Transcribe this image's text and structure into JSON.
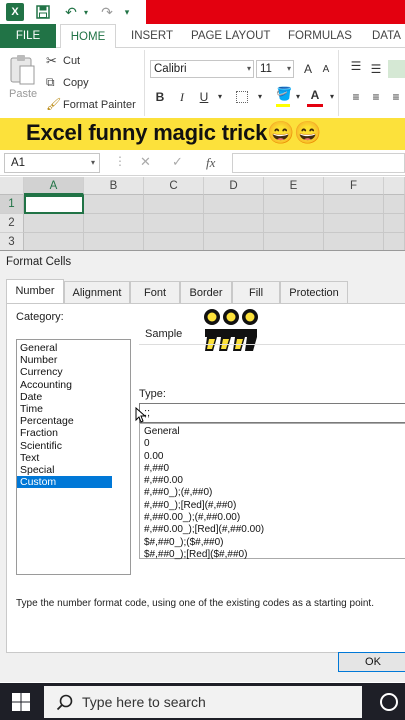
{
  "titlebar": {
    "logo": "X",
    "icons": [
      "excel-logo-icon",
      "save-icon",
      "undo-icon",
      "redo-icon",
      "customize-icon"
    ]
  },
  "ribbon_tabs": [
    "FILE",
    "HOME",
    "INSERT",
    "PAGE LAYOUT",
    "FORMULAS",
    "DATA"
  ],
  "clipboard": {
    "paste_label": "Paste",
    "cut_label": "Cut",
    "copy_label": "Copy",
    "format_painter_label": "Format Painter"
  },
  "font": {
    "name": "Calibri",
    "size": "11",
    "grow": "A",
    "shrink": "A",
    "bold": "B",
    "italic": "I",
    "underline": "U",
    "font_color": "A"
  },
  "banner": {
    "text": "Excel funny magic trick😄😄"
  },
  "formula_bar": {
    "name_box": "A1",
    "cancel": "✕",
    "enter": "✓",
    "fx": "fx"
  },
  "grid": {
    "columns": [
      "A",
      "B",
      "C",
      "D",
      "E",
      "F"
    ],
    "rows": [
      "1",
      "2",
      "3"
    ]
  },
  "dialog": {
    "title": "Format Cells",
    "tabs": [
      "Number",
      "Alignment",
      "Font",
      "Border",
      "Fill",
      "Protection"
    ],
    "active_tab": "Number",
    "category_label": "Category:",
    "categories": [
      "General",
      "Number",
      "Currency",
      "Accounting",
      "Date",
      "Time",
      "Percentage",
      "Fraction",
      "Scientific",
      "Text",
      "Special",
      "Custom"
    ],
    "selected_category": "Custom",
    "sample_label": "Sample",
    "type_label": "Type:",
    "type_value": ";;",
    "formats": [
      "General",
      "0",
      "0.00",
      "#,##0",
      "#,##0.00",
      "#,##0_);(#,##0)",
      "#,##0_);[Red](#,##0)",
      "#,##0.00_);(#,##0.00)",
      "#,##0.00_);[Red](#,##0.00)",
      "$#,##0_);($#,##0)",
      "$#,##0_);[Red]($#,##0)"
    ],
    "hint": "Type the number format code, using one of the existing codes as a starting point.",
    "ok_label": "OK"
  },
  "taskbar": {
    "search_placeholder": "Type here to search"
  },
  "colors": {
    "excel_green": "#217346",
    "title_red": "#e3000f",
    "banner_yellow": "#fce13b",
    "selection_blue": "#0078d7"
  }
}
